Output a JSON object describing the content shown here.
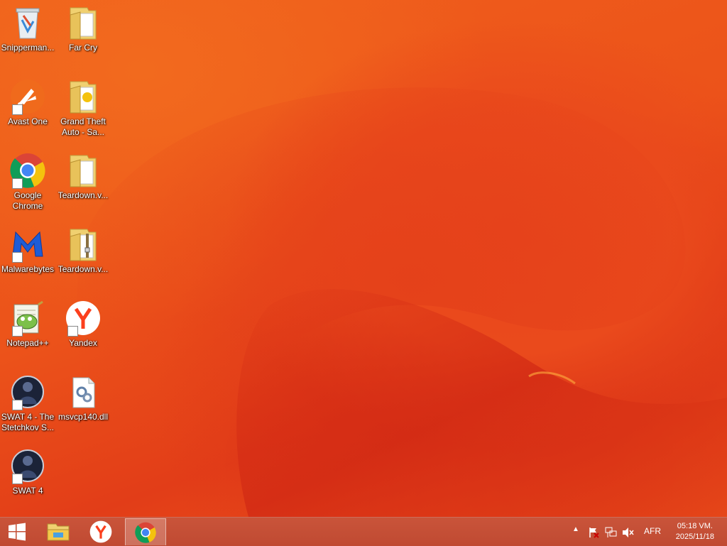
{
  "desktop_icons": [
    {
      "label": "Snipperman...",
      "icon": "recycle-bin-icon"
    },
    {
      "label": "Far Cry",
      "icon": "folder-icon"
    },
    {
      "label": "Avast One",
      "icon": "avast-icon"
    },
    {
      "label": "Grand Theft Auto - Sa...",
      "icon": "folder-icon"
    },
    {
      "label": "Google Chrome",
      "icon": "chrome-icon"
    },
    {
      "label": "Teardown.v...",
      "icon": "folder-icon"
    },
    {
      "label": "Malwarebytes",
      "icon": "malwarebytes-icon"
    },
    {
      "label": "Teardown.v...",
      "icon": "zip-folder-icon"
    },
    {
      "label": "Notepad++",
      "icon": "notepadpp-icon"
    },
    {
      "label": "Yandex",
      "icon": "yandex-icon"
    },
    {
      "label": "SWAT 4 - The Stetchkov S...",
      "icon": "swat-icon"
    },
    {
      "label": "msvcp140.dll",
      "icon": "dll-file-icon"
    },
    {
      "label": "SWAT 4",
      "icon": "swat-icon"
    }
  ],
  "taskbar": {
    "pinned": [
      {
        "name": "File Explorer",
        "icon": "file-explorer-icon"
      },
      {
        "name": "Yandex",
        "icon": "yandex-icon"
      },
      {
        "name": "Google Chrome",
        "icon": "chrome-icon",
        "active": true
      }
    ],
    "tray": {
      "language": "AFR",
      "time": "05:18 VM.",
      "date": "2025/11/18"
    }
  },
  "colors": {
    "wallpaper": "#ec531a",
    "taskbar": "#c44e36"
  }
}
